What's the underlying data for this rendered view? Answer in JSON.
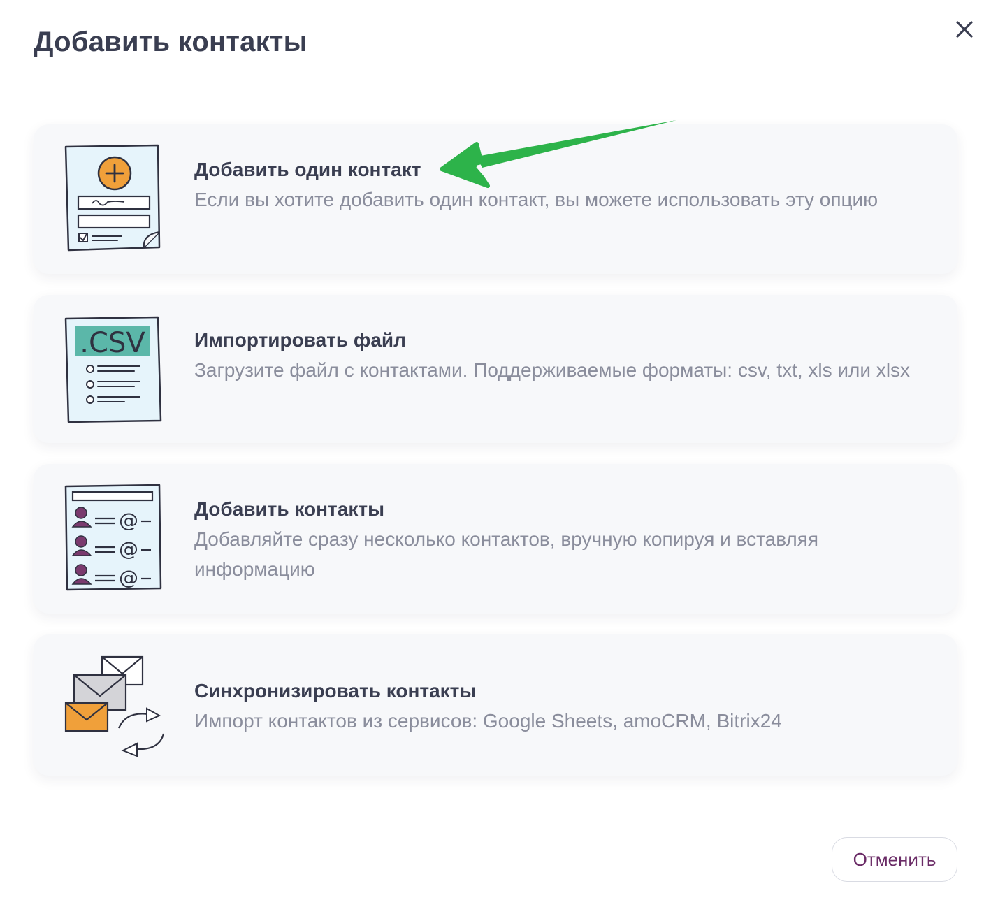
{
  "dialog": {
    "title": "Добавить контакты",
    "close_icon": "close-icon",
    "cancel_label": "Отменить"
  },
  "options": [
    {
      "title": "Добавить один контакт",
      "description": "Если вы хотите добавить один контакт, вы можете использовать эту опцию",
      "icon": "contact-form-icon"
    },
    {
      "title": "Импортировать файл",
      "description": "Загрузите файл с контактами. Поддерживаемые форматы: csv, txt, xls или xlsx",
      "icon": "csv-file-icon",
      "icon_text": ".CSV"
    },
    {
      "title": "Добавить контакты",
      "description": "Добавляйте сразу несколько контактов, вручную копируя и вставляя информацию",
      "icon": "contact-list-icon"
    },
    {
      "title": "Синхронизировать контакты",
      "description": "Импорт контактов из сервисов: Google Sheets, amoCRM, Bitrix24",
      "icon": "sync-envelopes-icon"
    }
  ],
  "colors": {
    "accent_orange": "#f0a03a",
    "csv_teal": "#5bb7a9",
    "paper_blue": "#e6f4fb",
    "person_purple": "#7a3a6e",
    "arrow_green": "#2db34a",
    "cancel_text": "#6a2b66"
  },
  "annotation": "green-arrow-pointer"
}
